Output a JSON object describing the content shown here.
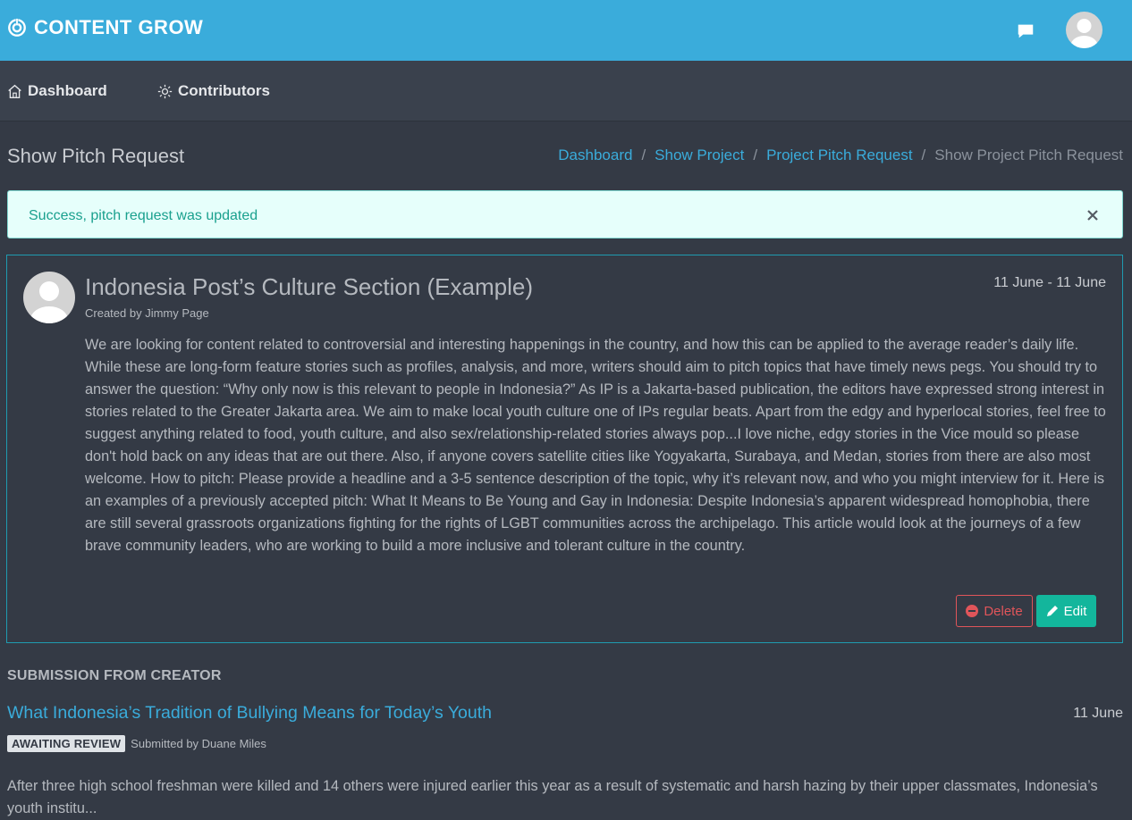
{
  "app": {
    "brand": "CONTENT GROW"
  },
  "nav": {
    "items": [
      {
        "label": "Dashboard",
        "icon": "home-icon"
      },
      {
        "label": "Contributors",
        "icon": "sun-icon"
      }
    ]
  },
  "page": {
    "title": "Show Pitch Request",
    "breadcrumb": [
      "Dashboard",
      "Show Project",
      "Project Pitch Request",
      "Show Project Pitch Request"
    ]
  },
  "alert": {
    "message": "Success, pitch request was updated"
  },
  "pitch": {
    "title": "Indonesia Post’s Culture Section (Example)",
    "date_range": "11 June - 11 June",
    "created_by": "Created by Jimmy Page",
    "body": "We are looking for content related to controversial and interesting happenings in the country, and how this can be applied to the average reader’s daily life. While these are long-form feature stories such as profiles, analysis, and more, writers should aim to pitch topics that have timely news pegs. You should try to answer the question: “Why only now is this relevant to people in Indonesia?” As IP is a Jakarta-based publication, the editors have expressed strong interest in stories related to the Greater Jakarta area. We aim to make local youth culture one of IPs regular beats. Apart from the edgy and hyperlocal stories, feel free to suggest anything related to food, youth culture, and also sex/relationship-related stories always pop...I love niche, edgy stories in the Vice mould so please don't hold back on any ideas that are out there. Also, if anyone covers satellite cities like Yogyakarta, Surabaya, and Medan, stories from there are also most welcome. How to pitch: Please provide a headline and a 3-5 sentence description of the topic, why it’s relevant now, and who you might interview for it. Here is an examples of a previously accepted pitch: What It Means to Be Young and Gay in Indonesia: Despite Indonesia’s apparent widespread homophobia, there are still several grassroots organizations fighting for the rights of LGBT communities across the archipelago. This article would look at the journeys of a few brave community leaders, who are working to build a more inclusive and tolerant culture in the country.",
    "delete_label": "Delete",
    "edit_label": "Edit"
  },
  "submission": {
    "heading": "SUBMISSION FROM CREATOR",
    "title": "What Indonesia’s Tradition of Bullying Means for Today’s Youth",
    "date": "11 June",
    "status": "AWAITING REVIEW",
    "submitted_by": "Submitted by Duane Miles",
    "body": "After three high school freshman were killed and 14 others were injured earlier this year as a result of systematic and harsh hazing by their upper classmates, Indonesia’s youth institu..."
  },
  "colors": {
    "topbar": "#3aacdb",
    "background": "#343a45",
    "accent": "#3aacdb",
    "success_bg": "#e6fffb",
    "success_text": "#1aa08e",
    "danger": "#e0555a",
    "edit": "#13b69c"
  }
}
